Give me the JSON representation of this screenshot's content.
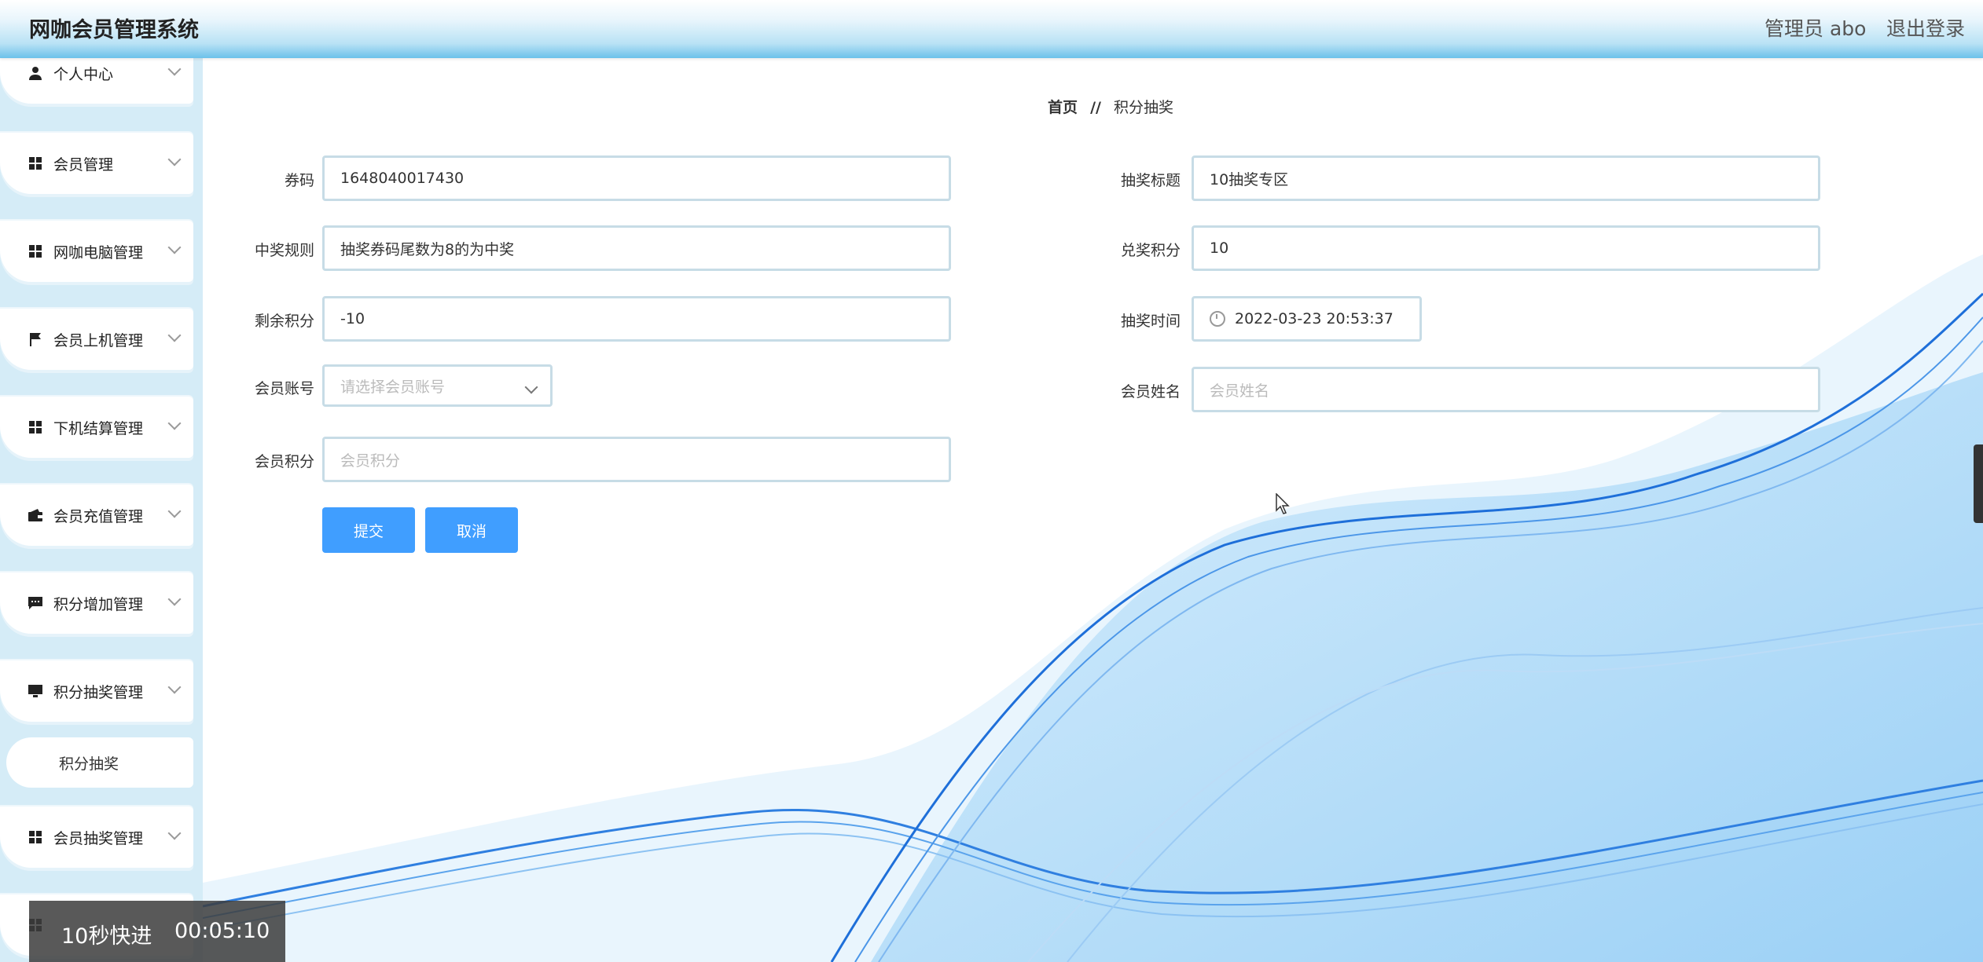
{
  "header": {
    "title": "网咖会员管理系统",
    "admin": "管理员 abo",
    "logout": "退出登录"
  },
  "sidebar": {
    "items": [
      {
        "label": "个人中心",
        "icon": "user-icon"
      },
      {
        "label": "会员管理",
        "icon": "grid-icon"
      },
      {
        "label": "网咖电脑管理",
        "icon": "grid-icon"
      },
      {
        "label": "会员上机管理",
        "icon": "flag-icon"
      },
      {
        "label": "下机结算管理",
        "icon": "grid-icon"
      },
      {
        "label": "会员充值管理",
        "icon": "wallet-icon"
      },
      {
        "label": "积分增加管理",
        "icon": "message-icon"
      },
      {
        "label": "积分抽奖管理",
        "icon": "monitor-icon"
      },
      {
        "label": "会员抽奖管理",
        "icon": "grid-icon"
      }
    ],
    "sub_item": "积分抽奖"
  },
  "breadcrumb": {
    "home": "首页",
    "separator": "//",
    "current": "积分抽奖"
  },
  "form": {
    "coupon": {
      "label": "券码",
      "value": "1648040017430"
    },
    "rule": {
      "label": "中奖规则",
      "value": "抽奖券码尾数为8的为中奖"
    },
    "remaining": {
      "label": "剩余积分",
      "value": "-10"
    },
    "account": {
      "label": "会员账号",
      "placeholder": "请选择会员账号"
    },
    "points": {
      "label": "会员积分",
      "placeholder": "会员积分"
    },
    "lottery_title": {
      "label": "抽奖标题",
      "value": "10抽奖专区"
    },
    "redeem_points": {
      "label": "兑奖积分",
      "value": "10"
    },
    "lottery_time": {
      "label": "抽奖时间",
      "value": "2022-03-23 20:53:37"
    },
    "member_name": {
      "label": "会员姓名",
      "placeholder": "会员姓名"
    },
    "submit": "提交",
    "cancel": "取消"
  },
  "overlay": {
    "fast_forward": "10秒快进",
    "time": "00:05:10"
  },
  "colors": {
    "primary": "#409eff",
    "sidebar_bg": "#d5ecf7",
    "wave_blue": "#1e88e5"
  }
}
